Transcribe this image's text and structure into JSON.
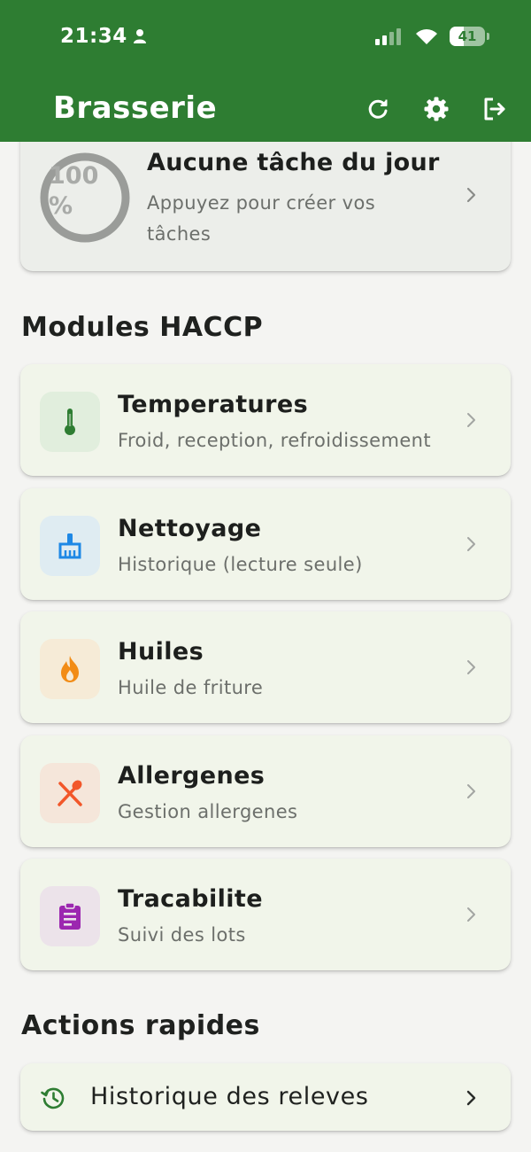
{
  "status_bar": {
    "time": "21:34",
    "battery": "41",
    "battery_level": 0.41
  },
  "app_bar": {
    "title": "Brasserie",
    "color": "#2e7d32",
    "actions": [
      "refresh-icon",
      "settings-icon",
      "logout-icon"
    ]
  },
  "daily_tasks": {
    "progress_text": "100 %",
    "title": "Aucune tâche du jour",
    "subtitle": "Appuyez pour créer vos tâches"
  },
  "modules_section": {
    "title": "Modules HACCP",
    "items": [
      {
        "title": "Temperatures",
        "subtitle": "Froid, reception, refroidissement",
        "icon": "thermometer-icon",
        "color": "#2e7d32",
        "bg": "#e1eedd"
      },
      {
        "title": "Nettoyage",
        "subtitle": "Historique (lecture seule)",
        "icon": "cleaning-brush-icon",
        "color": "#1e88e5",
        "bg": "#dfecf2"
      },
      {
        "title": "Huiles",
        "subtitle": "Huile de friture",
        "icon": "flame-icon",
        "color": "#f28c16",
        "bg": "#f6ebd7"
      },
      {
        "title": "Allergenes",
        "subtitle": "Gestion allergenes",
        "icon": "utensils-crossed-icon",
        "color": "#f2572a",
        "bg": "#f5e6da"
      },
      {
        "title": "Tracabilite",
        "subtitle": "Suivi des lots",
        "icon": "clipboard-icon",
        "color": "#9c27b0",
        "bg": "#ece3ea"
      }
    ]
  },
  "quick_actions": {
    "title": "Actions rapides",
    "items": [
      {
        "label": "Historique des releves",
        "icon": "history-icon",
        "color": "#2e7d32"
      }
    ]
  }
}
